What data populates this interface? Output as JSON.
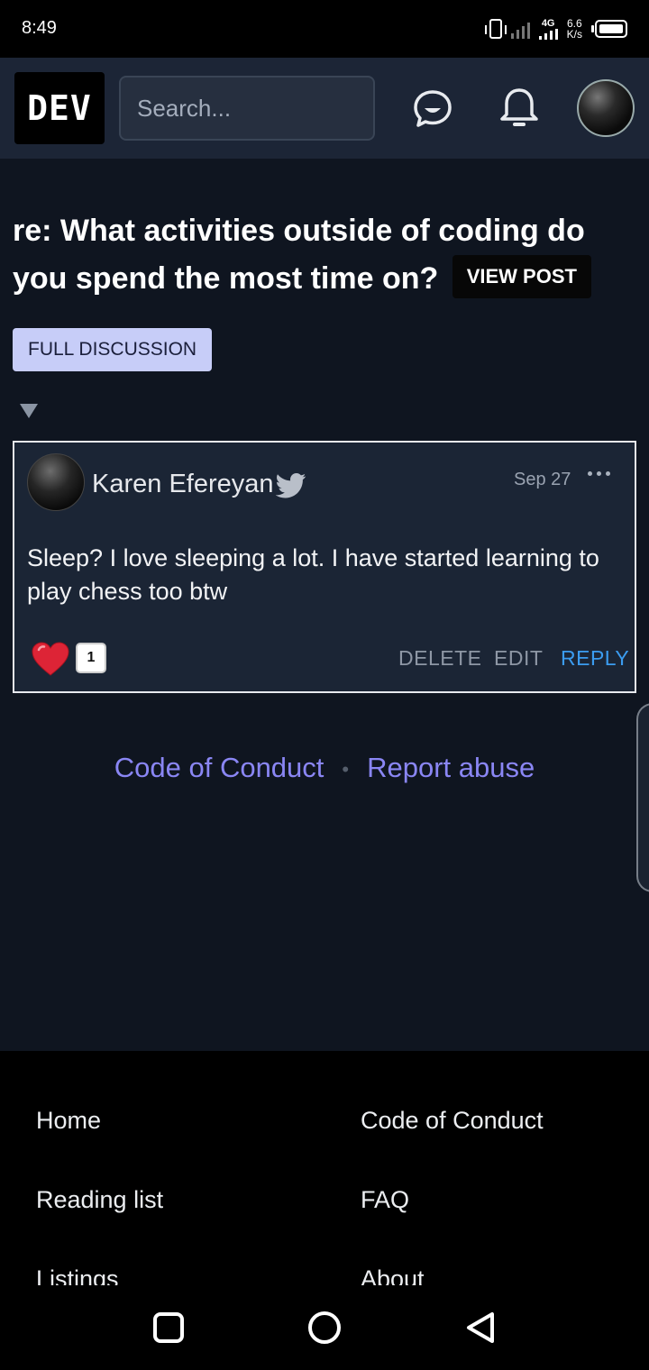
{
  "status_bar": {
    "time": "8:49",
    "network": "4G",
    "net_speed": "6.6",
    "net_unit": "K/s"
  },
  "header": {
    "logo": "DEV",
    "search_placeholder": "Search...",
    "icons": [
      "chat-icon",
      "bell-icon",
      "profile-avatar"
    ]
  },
  "post": {
    "title": "re: What activities outside of coding do you spend the most time on?",
    "view_post_label": "VIEW POST",
    "full_discussion_label": "FULL DISCUSSION"
  },
  "comment": {
    "author": "Karen Efereyan",
    "date": "Sep 27",
    "body": "Sleep? I love sleeping a lot. I have started learning to play chess too btw",
    "reaction_count": "1",
    "actions": {
      "delete": "DELETE",
      "edit": "EDIT",
      "reply": "REPLY"
    }
  },
  "footer": {
    "code_of_conduct": "Code of Conduct",
    "report_abuse": "Report abuse",
    "separator": "•"
  },
  "bottom_nav": {
    "left": [
      "Home",
      "Reading list",
      "Listings"
    ],
    "right": [
      "Code of Conduct",
      "FAQ",
      "About"
    ]
  },
  "colors": {
    "accent_link": "#8a86f4",
    "reply": "#3b9cf0",
    "background": "#0f1520"
  }
}
